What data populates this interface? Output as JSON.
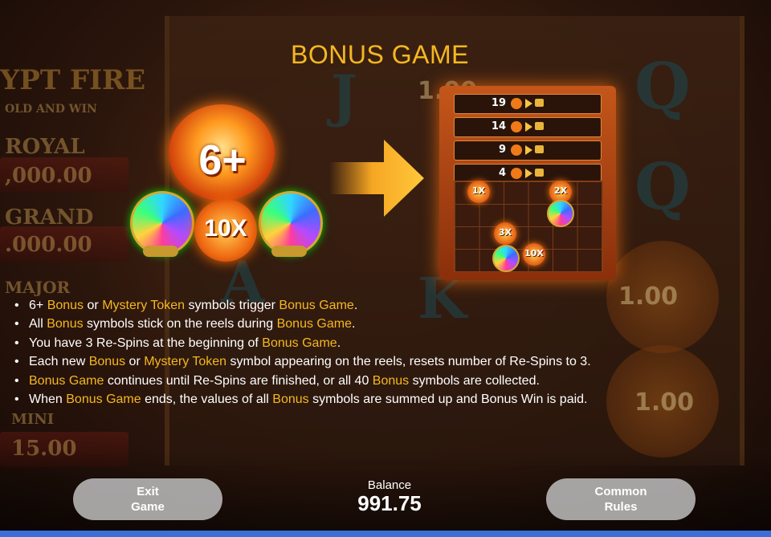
{
  "title": "BONUS GAME",
  "background": {
    "logo": "YPT FIRE",
    "logo_sub": "OLD AND WIN",
    "jackpots": [
      {
        "name": "ROYAL",
        "value": ",000.00"
      },
      {
        "name": "GRAND",
        "value": ".000.00"
      },
      {
        "name": "MAJOR",
        "value": ""
      },
      {
        "name": "MINI",
        "value": "15.00"
      }
    ],
    "reel_values": [
      "1.00",
      "1.00",
      "1.00"
    ]
  },
  "illustration": {
    "trigger_label": "6+",
    "token_label": "10X",
    "preview_rows": [
      "19",
      "14",
      "9",
      "4"
    ],
    "preview_tokens": [
      "1X",
      "2X",
      "3X",
      "10X"
    ]
  },
  "rules": [
    [
      {
        "t": "6+ "
      },
      {
        "t": "Bonus",
        "h": true
      },
      {
        "t": " or "
      },
      {
        "t": "Mystery Token",
        "h": true
      },
      {
        "t": " symbols trigger "
      },
      {
        "t": "Bonus Game",
        "h": true
      },
      {
        "t": "."
      }
    ],
    [
      {
        "t": "All "
      },
      {
        "t": "Bonus",
        "h": true
      },
      {
        "t": " symbols stick on the reels during "
      },
      {
        "t": "Bonus Game",
        "h": true
      },
      {
        "t": "."
      }
    ],
    [
      {
        "t": "You have 3 Re-Spins at the beginning of "
      },
      {
        "t": "Bonus Game",
        "h": true
      },
      {
        "t": "."
      }
    ],
    [
      {
        "t": "Each new "
      },
      {
        "t": "Bonus",
        "h": true
      },
      {
        "t": " or "
      },
      {
        "t": "Mystery Token",
        "h": true
      },
      {
        "t": " symbol appearing on the reels, resets number of Re-Spins to 3."
      }
    ],
    [
      {
        "t": "Bonus Game",
        "h": true
      },
      {
        "t": " continues until Re-Spins are finished, or all 40 "
      },
      {
        "t": "Bonus",
        "h": true
      },
      {
        "t": " symbols are collected."
      }
    ],
    [
      {
        "t": "When "
      },
      {
        "t": "Bonus Game",
        "h": true
      },
      {
        "t": " ends, the values of all "
      },
      {
        "t": "Bonus",
        "h": true
      },
      {
        "t": " symbols are summed up and Bonus Win is paid."
      }
    ]
  ],
  "footer": {
    "exit_line1": "Exit",
    "exit_line2": "Game",
    "balance_label": "Balance",
    "balance_value": "991.75",
    "common_line1": "Common",
    "common_line2": "Rules"
  },
  "colors": {
    "highlight": "#f5b820",
    "accent_bar": "#3a6fd8"
  }
}
